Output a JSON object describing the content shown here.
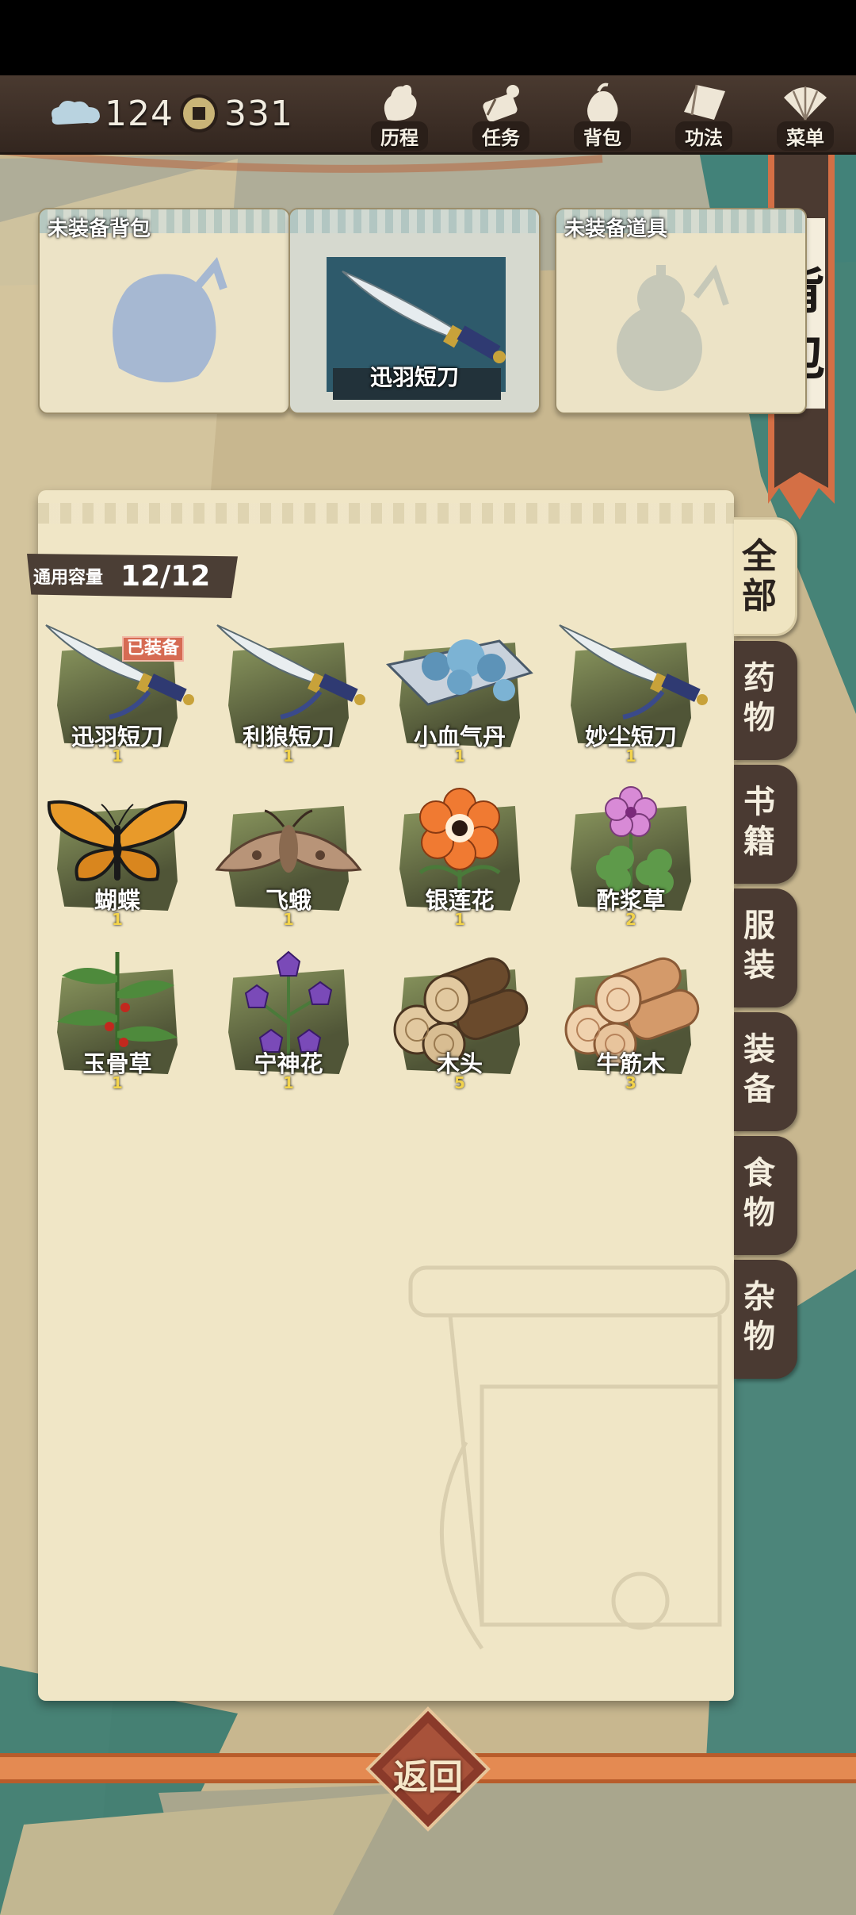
{
  "currency": {
    "spirit": "124",
    "coins": "331"
  },
  "nav": [
    {
      "label": "历程",
      "icon": "journey-icon"
    },
    {
      "label": "任务",
      "icon": "task-scroll-icon"
    },
    {
      "label": "背包",
      "icon": "bag-icon"
    },
    {
      "label": "功法",
      "icon": "book-icon"
    },
    {
      "label": "菜单",
      "icon": "fan-menu-icon"
    }
  ],
  "title": "背包",
  "slots": {
    "bag": {
      "label": "未装备背包"
    },
    "weapon": {
      "label": "迅羽短刀"
    },
    "tool": {
      "label": "未装备道具"
    }
  },
  "capacity": {
    "label": "通用容量",
    "value": "12/12"
  },
  "equipped_badge": "已装备",
  "items": [
    {
      "name": "迅羽短刀",
      "count": "1",
      "icon": "dagger-icon"
    },
    {
      "name": "利狼短刀",
      "count": "1",
      "icon": "dagger-icon"
    },
    {
      "name": "小血气丹",
      "count": "1",
      "icon": "pill-icon"
    },
    {
      "name": "妙尘短刀",
      "count": "1",
      "icon": "dagger-icon"
    },
    {
      "name": "蝴蝶",
      "count": "1",
      "icon": "butterfly-icon"
    },
    {
      "name": "飞蛾",
      "count": "1",
      "icon": "moth-icon"
    },
    {
      "name": "银莲花",
      "count": "1",
      "icon": "anemone-icon"
    },
    {
      "name": "酢浆草",
      "count": "2",
      "icon": "oxalis-icon"
    },
    {
      "name": "玉骨草",
      "count": "1",
      "icon": "herb-icon"
    },
    {
      "name": "宁神花",
      "count": "1",
      "icon": "bellflower-icon"
    },
    {
      "name": "木头",
      "count": "5",
      "icon": "wood-icon"
    },
    {
      "name": "牛筋木",
      "count": "3",
      "icon": "wood-icon"
    }
  ],
  "tabs": [
    {
      "label": "全部",
      "active": true
    },
    {
      "label": "药物"
    },
    {
      "label": "书籍"
    },
    {
      "label": "服装"
    },
    {
      "label": "装备"
    },
    {
      "label": "食物"
    },
    {
      "label": "杂物"
    }
  ],
  "back": "返回",
  "colors": {
    "panel": "#f0e6c6",
    "tab": "#4a3a32",
    "accent": "#e48a52",
    "count": "#f2d34c"
  }
}
